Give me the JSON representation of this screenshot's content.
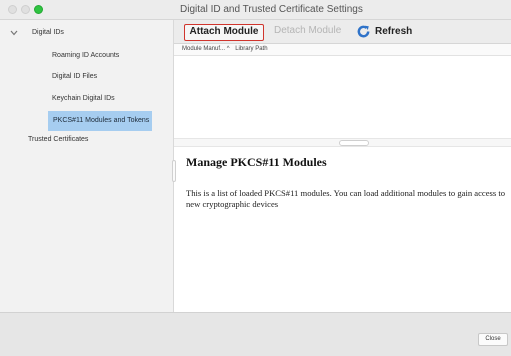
{
  "window": {
    "title": "Digital ID and Trusted Certificate Settings"
  },
  "sidebar": {
    "items": [
      {
        "label": "Digital IDs",
        "expanded": true
      },
      {
        "label": "Roaming ID Accounts"
      },
      {
        "label": "Digital ID Files"
      },
      {
        "label": "Keychain Digital IDs"
      },
      {
        "label": "PKCS#11 Modules and Tokens",
        "selected": true
      },
      {
        "label": "Trusted Certificates"
      }
    ]
  },
  "toolbar": {
    "attach_label": "Attach Module",
    "detach_label": "Detach Module",
    "refresh_label": "Refresh"
  },
  "table": {
    "columns": [
      "Module Manuf... ^",
      "Library Path"
    ]
  },
  "info": {
    "heading": "Manage PKCS#11 Modules",
    "body": "This is a list of loaded PKCS#11 modules. You can load additional modules to gain access to new cryptographic devices"
  },
  "footer": {
    "close_label": "Close"
  },
  "colors": {
    "selection": "#a6cdf0",
    "highlight_border": "#d0352d",
    "refresh_icon": "#2f73c9"
  }
}
